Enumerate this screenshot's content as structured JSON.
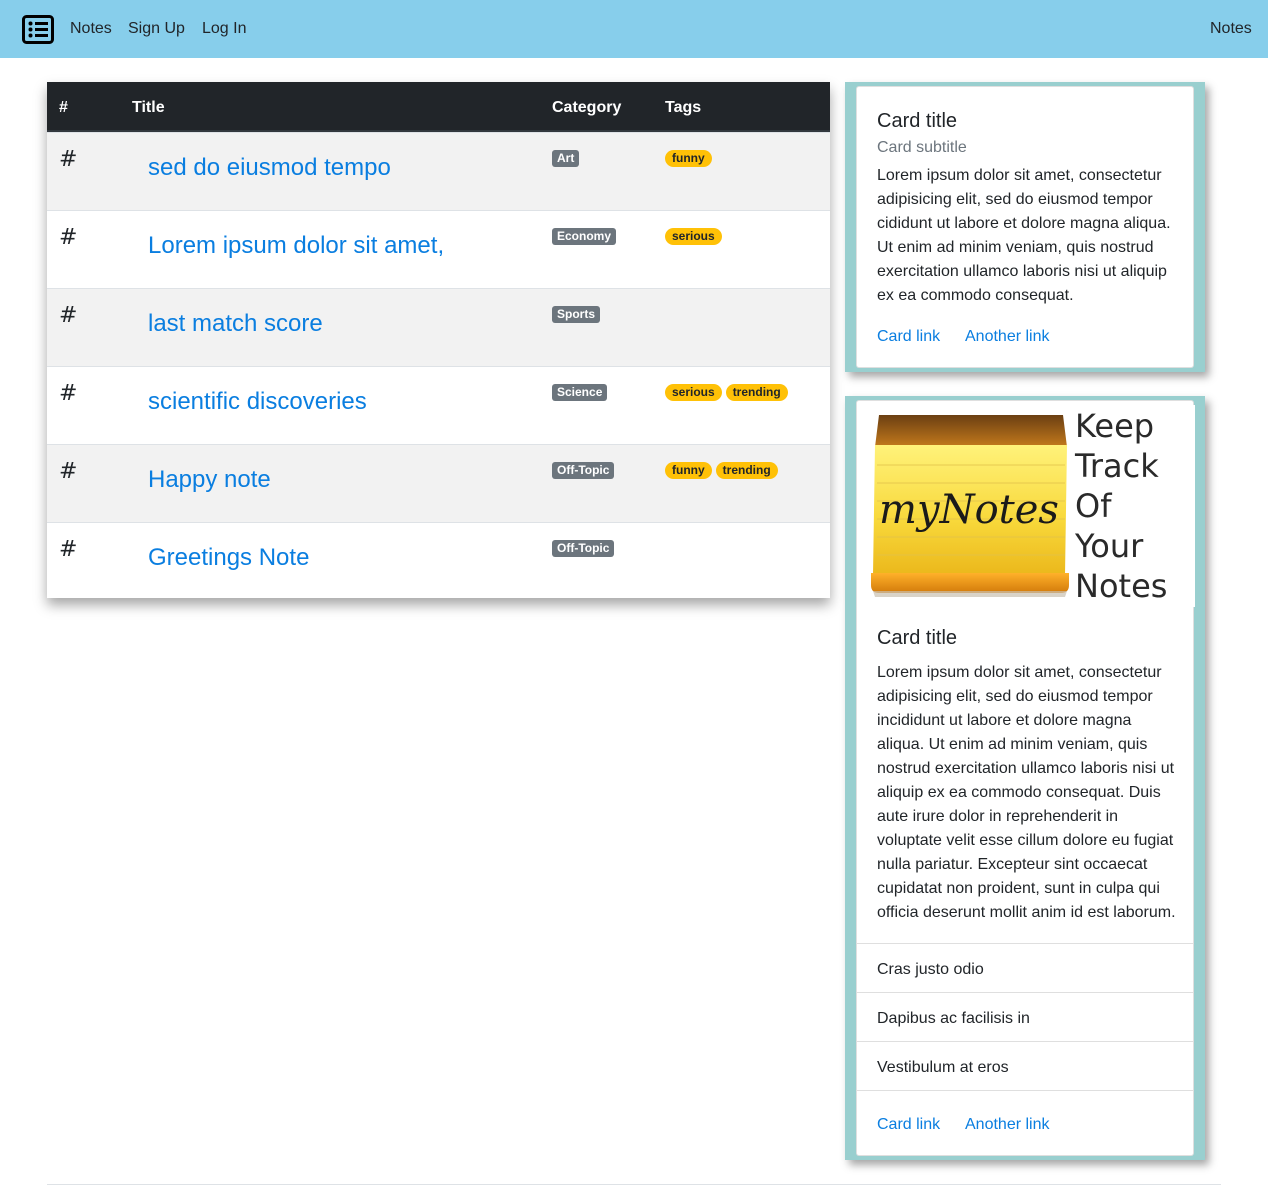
{
  "navbar": {
    "brand_icon": "list-icon",
    "links": [
      "Notes",
      "Sign Up",
      "Log In"
    ],
    "right_link": "Notes"
  },
  "table": {
    "headers": [
      "#",
      "Title",
      "Category",
      "Tags"
    ],
    "rows": [
      {
        "num": "#",
        "title": "sed do eiusmod tempo",
        "category": "Art",
        "tags": [
          "funny"
        ]
      },
      {
        "num": "#",
        "title": "Lorem ipsum dolor sit amet,",
        "category": "Economy",
        "tags": [
          "serious"
        ]
      },
      {
        "num": "#",
        "title": "last match score",
        "category": "Sports",
        "tags": []
      },
      {
        "num": "#",
        "title": "scientific discoveries",
        "category": "Science",
        "tags": [
          "serious",
          "trending"
        ]
      },
      {
        "num": "#",
        "title": "Happy note",
        "category": "Off-Topic",
        "tags": [
          "funny",
          "trending"
        ]
      },
      {
        "num": "#",
        "title": "Greetings Note",
        "category": "Off-Topic",
        "tags": []
      }
    ]
  },
  "card1": {
    "title": "Card title",
    "subtitle": "Card subtitle",
    "text": "Lorem ipsum dolor sit amet, consectetur adipisicing elit, sed do eiusmod tempor cididunt ut labore et dolore magna aliqua. Ut enim ad minim veniam, quis nostrud exercitation ullamco laboris nisi ut aliquip ex ea commodo consequat.",
    "link1": "Card link",
    "link2": "Another link"
  },
  "card2": {
    "image_logo_text": "myNotes",
    "image_slogan_lines": [
      "Keep",
      "Track",
      "Of",
      "Your",
      "Notes"
    ],
    "title": "Card title",
    "text": "Lorem ipsum dolor sit amet, consectetur adipisicing elit, sed do eiusmod tempor incididunt ut labore et dolore magna aliqua. Ut enim ad minim veniam, quis nostrud exercitation ullamco laboris nisi ut aliquip ex ea commodo consequat. Duis aute irure dolor in reprehenderit in voluptate velit esse cillum dolore eu fugiat nulla pariatur. Excepteur sint occaecat cupidatat non proident, sunt in culpa qui officia deserunt mollit anim id est laborum.",
    "list_items": [
      "Cras justo odio",
      "Dapibus ac facilisis in",
      "Vestibulum at eros"
    ],
    "link1": "Card link",
    "link2": "Another link"
  },
  "colors": {
    "navbar": "#87ceeb",
    "table_header": "#212529",
    "link": "#0a7ee0",
    "category_badge": "#6c757d",
    "tag_badge": "#ffc107",
    "card_frame": "#99cfcf"
  }
}
